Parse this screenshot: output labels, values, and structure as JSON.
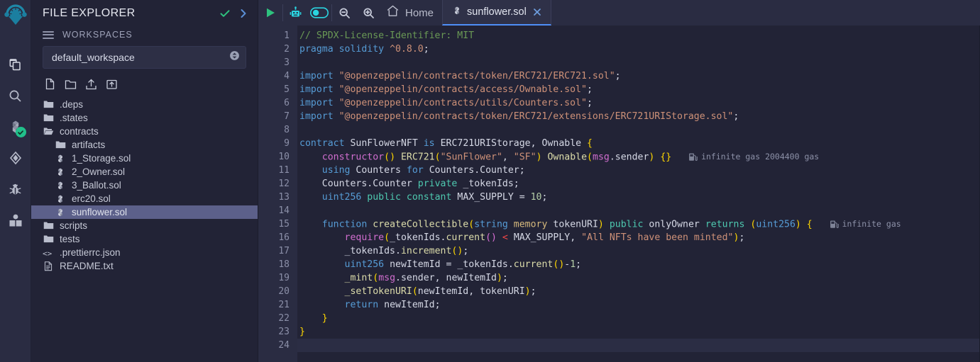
{
  "app": {
    "name": "Remix IDE",
    "logo_icon": "remix-logo-icon",
    "accent": "#1e88a8",
    "bg": "#222336",
    "panel_bg": "#2a2c42",
    "selection_bg": "#5c608a"
  },
  "iconbar": {
    "items": [
      {
        "name": "file-explorer-icon",
        "icon": "files-copy-icon",
        "badge": ""
      },
      {
        "name": "search-icon",
        "icon": "magnifier-icon",
        "badge": ""
      },
      {
        "name": "solidity-compiler-icon",
        "icon": "solidity-logo-icon",
        "badge": "check"
      },
      {
        "name": "deploy-run-icon",
        "icon": "ethereum-diamond-icon",
        "badge": ""
      },
      {
        "name": "debugger-icon",
        "icon": "bug-icon",
        "badge": ""
      },
      {
        "name": "plugin-manager-icon",
        "icon": "book-icon",
        "badge": ""
      }
    ]
  },
  "explorer": {
    "title": "FILE EXPLORER",
    "header_icons": [
      {
        "name": "check-icon",
        "glyph": "check",
        "color": "#2ec27e"
      },
      {
        "name": "chevron-right-icon",
        "glyph": "chevron",
        "color": "#5b8fd6"
      }
    ],
    "workspaces_label": "WORKSPACES",
    "workspace_select": {
      "value": "default_workspace",
      "icon": "updown-chevron-circle-icon"
    },
    "file_actions": [
      {
        "name": "create-new-file-button",
        "icon": "new-file-icon"
      },
      {
        "name": "create-new-folder-button",
        "icon": "new-folder-icon"
      },
      {
        "name": "publish-to-gist-button",
        "icon": "upload-icon"
      },
      {
        "name": "upload-folder-button",
        "icon": "upload-folder-icon"
      }
    ],
    "tree": [
      {
        "label": ".deps",
        "icon": "folder-icon",
        "depth": 0,
        "selected": false
      },
      {
        "label": ".states",
        "icon": "folder-icon",
        "depth": 0,
        "selected": false
      },
      {
        "label": "contracts",
        "icon": "folder-open-icon",
        "depth": 0,
        "selected": false
      },
      {
        "label": "artifacts",
        "icon": "folder-icon",
        "depth": 1,
        "selected": false
      },
      {
        "label": "1_Storage.sol",
        "icon": "solidity-file-icon",
        "depth": 1,
        "selected": false
      },
      {
        "label": "2_Owner.sol",
        "icon": "solidity-file-icon",
        "depth": 1,
        "selected": false
      },
      {
        "label": "3_Ballot.sol",
        "icon": "solidity-file-icon",
        "depth": 1,
        "selected": false
      },
      {
        "label": "erc20.sol",
        "icon": "solidity-file-icon",
        "depth": 1,
        "selected": false
      },
      {
        "label": "sunflower.sol",
        "icon": "solidity-file-icon",
        "depth": 1,
        "selected": true
      },
      {
        "label": "scripts",
        "icon": "folder-icon",
        "depth": 0,
        "selected": false
      },
      {
        "label": "tests",
        "icon": "folder-icon",
        "depth": 0,
        "selected": false
      },
      {
        "label": ".prettierrc.json",
        "icon": "json-file-icon",
        "depth": 0,
        "selected": false
      },
      {
        "label": "README.txt",
        "icon": "text-file-icon",
        "depth": 0,
        "selected": false
      }
    ]
  },
  "toolbar": {
    "run_button": {
      "name": "run-script-button",
      "icon": "play-icon",
      "color": "#2ec27e"
    },
    "ai_button": {
      "name": "remix-ai-button",
      "icon": "robot-icon",
      "color": "#2ad4e0"
    },
    "ai_toggle": {
      "name": "remix-ai-toggle",
      "icon": "toggle-switch-icon",
      "state": "on",
      "color": "#2ad4e0"
    },
    "zoom_out_button": {
      "name": "zoom-out-button",
      "icon": "magnifier-minus-icon"
    },
    "zoom_in_button": {
      "name": "zoom-in-button",
      "icon": "magnifier-plus-icon"
    },
    "home": {
      "name": "home-tab",
      "icon": "home-icon",
      "label": "Home"
    },
    "tabs": [
      {
        "name": "editor-tab-sunflower",
        "label": "sunflower.sol",
        "icon": "solidity-file-icon",
        "active": true,
        "close_icon": "close-icon"
      }
    ]
  },
  "editor": {
    "total_lines": 24,
    "current_line": 24,
    "line_numbers": [
      "1",
      "2",
      "3",
      "4",
      "5",
      "6",
      "7",
      "8",
      "9",
      "10",
      "11",
      "12",
      "13",
      "14",
      "15",
      "16",
      "17",
      "18",
      "19",
      "20",
      "21",
      "22",
      "23",
      "24"
    ],
    "gas_estimates": [
      {
        "line": 10,
        "icon": "gas-pump-icon",
        "text": "infinite gas 2004400 gas"
      },
      {
        "line": 15,
        "icon": "gas-pump-icon",
        "text": "infinite gas"
      }
    ],
    "code_plain": [
      "// SPDX-License-Identifier: MIT",
      "pragma solidity ^0.8.0;",
      "",
      "import \"@openzeppelin/contracts/token/ERC721/ERC721.sol\";",
      "import \"@openzeppelin/contracts/access/Ownable.sol\";",
      "import \"@openzeppelin/contracts/utils/Counters.sol\";",
      "import \"@openzeppelin/contracts/token/ERC721/extensions/ERC721URIStorage.sol\";",
      "",
      "contract SunFlowerNFT is ERC721URIStorage, Ownable {",
      "    constructor() ERC721(\"SunFlower\", \"SF\") Ownable(msg.sender) {}",
      "    using Counters for Counters.Counter;",
      "    Counters.Counter private _tokenIds;",
      "    uint256 public constant MAX_SUPPLY = 10;",
      "",
      "    function createCollectible(string memory tokenURI) public onlyOwner returns (uint256) {",
      "        require(_tokenIds.current() < MAX_SUPPLY, \"All NFTs have been minted\");",
      "        _tokenIds.increment();",
      "        uint256 newItemId = _tokenIds.current()-1;",
      "        _mint(msg.sender, newItemId);",
      "        _setTokenURI(newItemId, tokenURI);",
      "        return newItemId;",
      "    }",
      "}",
      ""
    ]
  }
}
